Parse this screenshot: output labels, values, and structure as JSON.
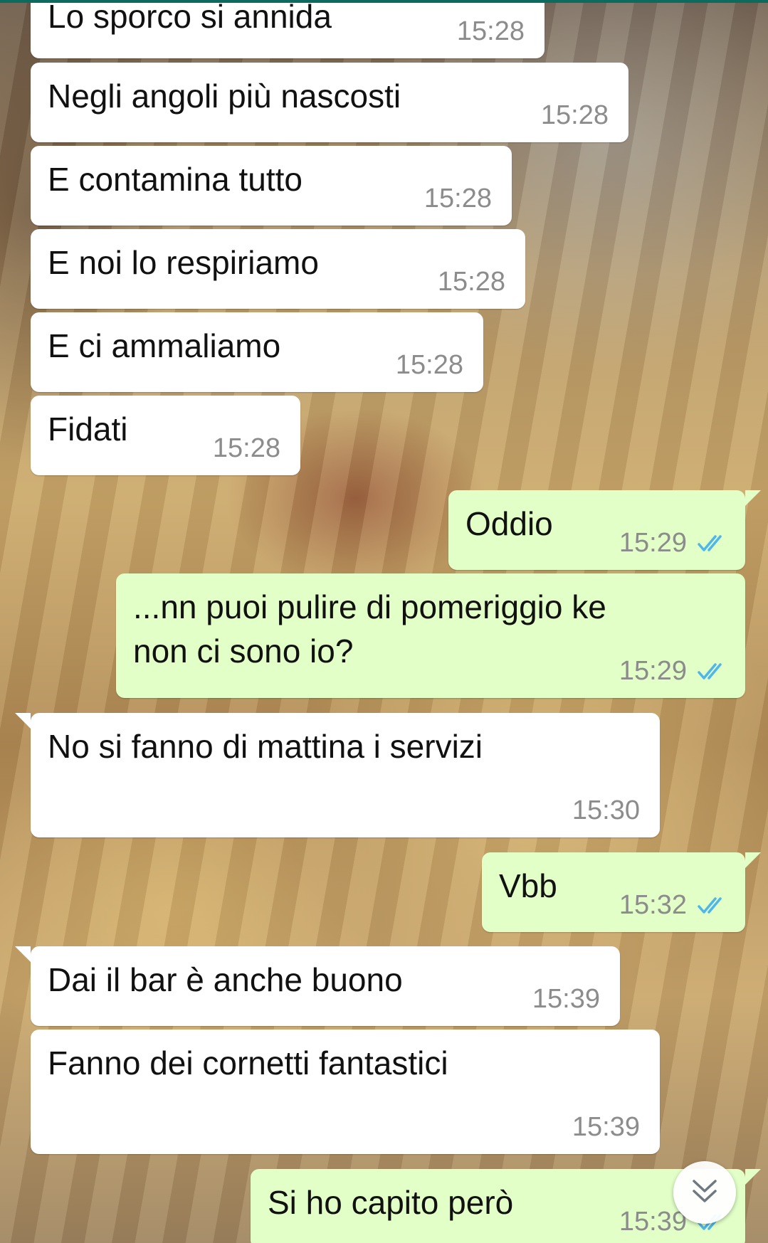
{
  "chat": {
    "messages": [
      {
        "direction": "in",
        "text": "Lo sporco si annida",
        "time": "15:28"
      },
      {
        "direction": "in",
        "text": "Negli angoli più nascosti",
        "time": "15:28"
      },
      {
        "direction": "in",
        "text": "E contamina tutto",
        "time": "15:28"
      },
      {
        "direction": "in",
        "text": "E noi lo respiriamo",
        "time": "15:28"
      },
      {
        "direction": "in",
        "text": "E ci ammaliamo",
        "time": "15:28"
      },
      {
        "direction": "in",
        "text": "Fidati",
        "time": "15:28"
      },
      {
        "direction": "out",
        "text": "Oddio",
        "time": "15:29",
        "status": "read"
      },
      {
        "direction": "out",
        "text": "...nn puoi pulire di pomeriggio ke\nnon ci sono io?",
        "time": "15:29",
        "status": "read"
      },
      {
        "direction": "in",
        "text": "No si fanno di mattina i servizi",
        "time": "15:30"
      },
      {
        "direction": "out",
        "text": "Vbb",
        "time": "15:32",
        "status": "read"
      },
      {
        "direction": "in",
        "text": "Dai il bar è anche buono",
        "time": "15:39"
      },
      {
        "direction": "in",
        "text": "Fanno dei cornetti fantastici",
        "time": "15:39"
      },
      {
        "direction": "out",
        "text": "Si ho capito però",
        "time": "15:39",
        "status": "read"
      }
    ]
  },
  "icons": {
    "read_receipt": "double-check-icon",
    "scroll_down": "double-chevron-down-icon"
  },
  "colors": {
    "incoming_bubble": "#ffffff",
    "outgoing_bubble": "#e1ffc7",
    "read_tick": "#4fb6ec",
    "timestamp": "#8c8c8c"
  }
}
